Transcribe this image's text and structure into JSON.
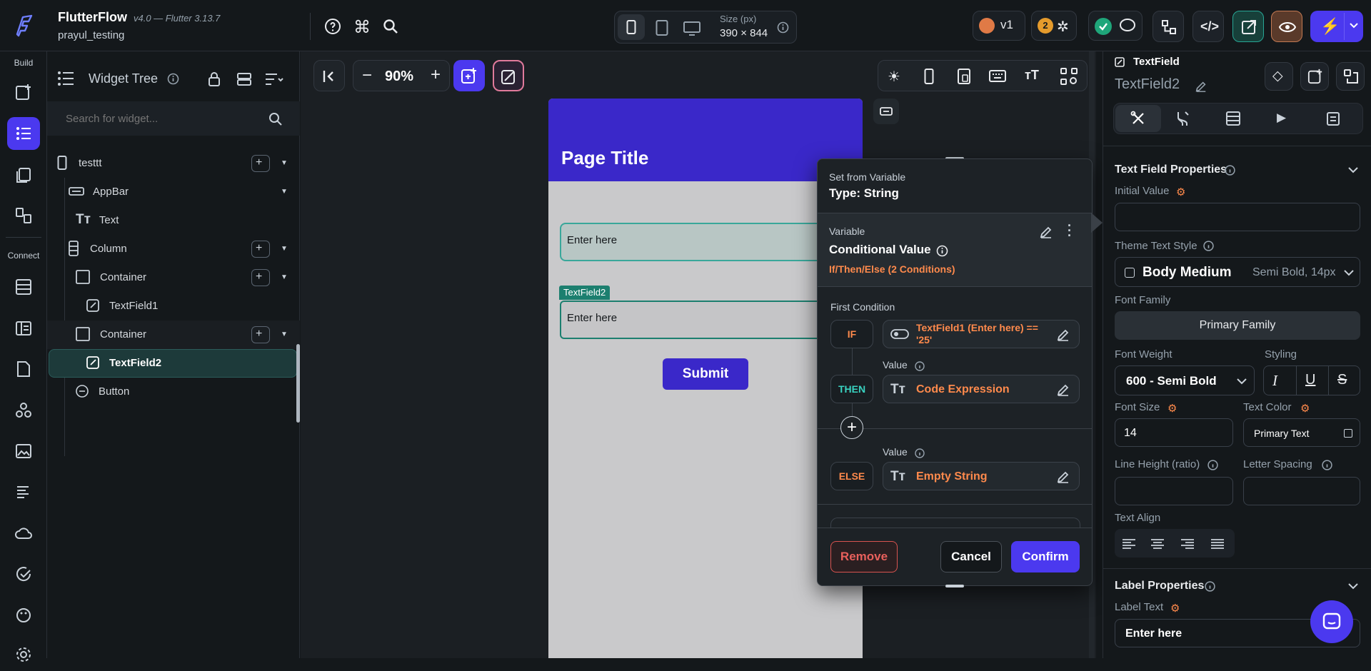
{
  "app": {
    "name": "FlutterFlow",
    "version": "v4.0 — Flutter 3.13.7",
    "project": "prayul_testing"
  },
  "topbar": {
    "size_label": "Size (px)",
    "size_value": "390 × 844",
    "version_badge": "v1",
    "bug_count": "2"
  },
  "rail": {
    "build_label": "Build",
    "connect_label": "Connect"
  },
  "tree": {
    "title": "Widget Tree",
    "search_placeholder": "Search for widget...",
    "items": [
      {
        "label": "testtt"
      },
      {
        "label": "AppBar"
      },
      {
        "label": "Text"
      },
      {
        "label": "Column"
      },
      {
        "label": "Container"
      },
      {
        "label": "TextField1"
      },
      {
        "label": "Container"
      },
      {
        "label": "TextField2"
      },
      {
        "label": "Button"
      }
    ]
  },
  "canvas": {
    "zoom": "90%",
    "page_title": "Page Title",
    "field1_hint": "Enter here",
    "field2_tag": "TextField2",
    "field2_hint": "Enter here",
    "submit_label": "Submit"
  },
  "popup": {
    "header_small": "Set from Variable",
    "header_type": "Type: String",
    "variable_label": "Variable",
    "variable_value": "Conditional Value",
    "variable_sub": "If/Then/Else (2 Conditions)",
    "first_condition": "First Condition",
    "if_tag": "IF",
    "if_text": "TextField1 (Enter here) == '25'",
    "then_tag": "THEN",
    "value_label": "Value",
    "then_text": "Code Expression",
    "else_tag": "ELSE",
    "else_value_label": "Value",
    "else_text": "Empty String",
    "remove": "Remove",
    "cancel": "Cancel",
    "confirm": "Confirm"
  },
  "props": {
    "widget_type": "TextField",
    "widget_name": "TextField2",
    "section_title": "Text Field Properties",
    "initial_value": "Initial Value",
    "theme_text_style": "Theme Text Style",
    "style_name": "Body Medium",
    "style_detail": "Semi Bold, 14px",
    "font_family_label": "Font Family",
    "font_family_value": "Primary Family",
    "font_weight_label": "Font Weight",
    "font_weight_value": "600 - Semi Bold",
    "styling_label": "Styling",
    "font_size_label": "Font Size",
    "font_size_value": "14",
    "text_color_label": "Text Color",
    "text_color_value": "Primary Text",
    "line_height_label": "Line Height (ratio)",
    "letter_spacing_label": "Letter Spacing",
    "text_align_label": "Text Align",
    "label_section": "Label Properties",
    "label_text_label": "Label Text",
    "label_text_value": "Enter here"
  },
  "colors": {
    "accent": "#4b39ef",
    "orange": "#ff8a4c",
    "teal": "#39d2c0"
  }
}
